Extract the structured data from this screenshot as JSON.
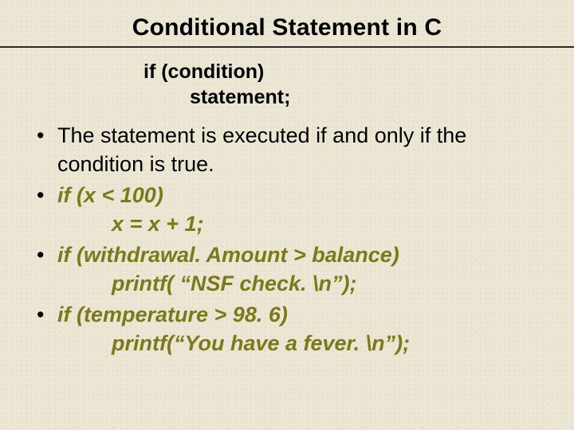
{
  "title": "Conditional Statement in C",
  "syntax": {
    "line1": "if (condition)",
    "line2": "statement;"
  },
  "bullets": {
    "b1": "The statement is executed if and only if the condition is true.",
    "b2": {
      "code": "if (x < 100)",
      "sub": "x = x + 1;"
    },
    "b3": {
      "code": "if (withdrawal. Amount > balance)",
      "sub": "printf( “NSF check. \\n”);"
    },
    "b4": {
      "code": "if (temperature > 98. 6)",
      "sub": "printf(“You have a fever. \\n”);"
    }
  }
}
